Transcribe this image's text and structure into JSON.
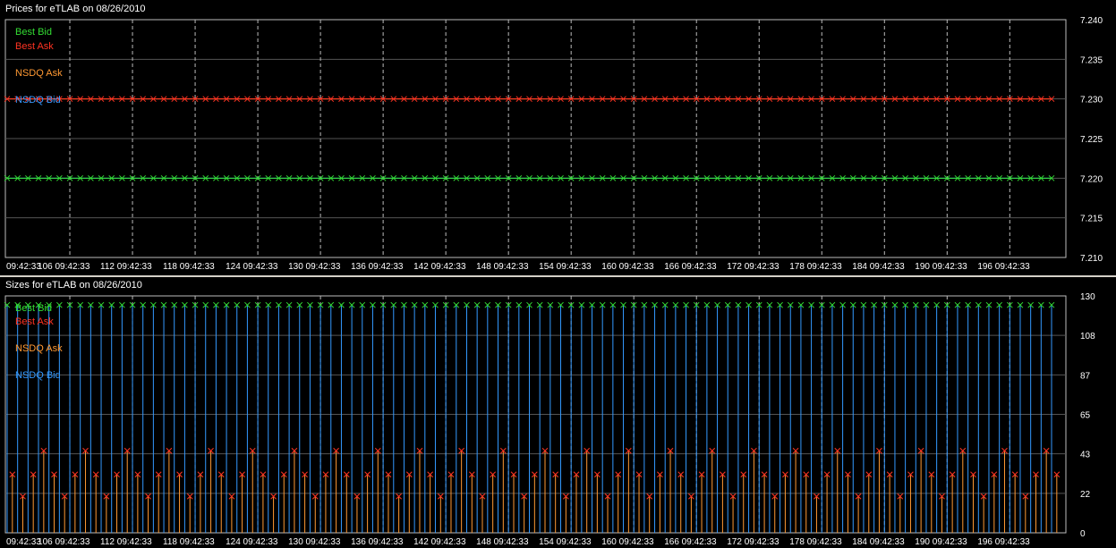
{
  "price_panel": {
    "title": "Prices for  eTLAB  on  08/26/2010"
  },
  "size_panel": {
    "title": "Sizes for  eTLAB  on  08/26/2010"
  },
  "legend": [
    {
      "label": "Best Bid",
      "color": "#33dd33"
    },
    {
      "label": "Best Ask",
      "color": "#ff3322"
    },
    {
      "label": "NSDQ Ask",
      "color": "#ff9933"
    },
    {
      "label": "NSDQ Bid",
      "color": "#3399ff"
    }
  ],
  "x_ticks": [
    "09:42:33",
    "106 09:42:33",
    "112 09:42:33",
    "118 09:42:33",
    "124 09:42:33",
    "130 09:42:33",
    "136 09:42:33",
    "142 09:42:33",
    "148 09:42:33",
    "154 09:42:33",
    "160 09:42:33",
    "166 09:42:33",
    "172 09:42:33",
    "178 09:42:33",
    "184 09:42:33",
    "190 09:42:33",
    "196 09:42:33"
  ],
  "chart_data": [
    {
      "type": "scatter",
      "title": "Prices for  eTLAB  on  08/26/2010",
      "ylim": [
        7.21,
        7.24
      ],
      "y_ticks": [
        "7.240",
        "7.235",
        "7.230",
        "7.225",
        "7.220",
        "7.215",
        "7.210"
      ],
      "grid": true,
      "legend_position": "top-left",
      "n_points": 101,
      "series": [
        {
          "name": "Best Bid",
          "color": "#33dd33",
          "constant_value": 7.22
        },
        {
          "name": "Best Ask",
          "color": "#ff3322",
          "constant_value": 7.23
        },
        {
          "name": "NSDQ Ask",
          "color": "#ff9933",
          "constant_value": 7.23
        },
        {
          "name": "NSDQ Bid",
          "color": "#3399ff",
          "constant_value": 7.22
        }
      ]
    },
    {
      "type": "scatter",
      "title": "Sizes for  eTLAB  on  08/26/2010",
      "ylim": [
        0,
        130
      ],
      "y_ticks": [
        "130",
        "108",
        "87",
        "65",
        "43",
        "22",
        "0"
      ],
      "grid": true,
      "legend_position": "top-left",
      "n_points": 101,
      "series": [
        {
          "name": "Best Bid",
          "color": "#33dd33",
          "constant_value": 125
        },
        {
          "name": "NSDQ Bid",
          "color": "#3399ff",
          "constant_value": 125
        },
        {
          "name": "Best Ask",
          "color": "#ff3322",
          "pattern": [
            32,
            20,
            32,
            45
          ],
          "pattern_offset": 0
        },
        {
          "name": "NSDQ Ask",
          "color": "#ff9933",
          "pattern": [
            32,
            20,
            32,
            45
          ],
          "pattern_offset": 0
        }
      ]
    }
  ]
}
